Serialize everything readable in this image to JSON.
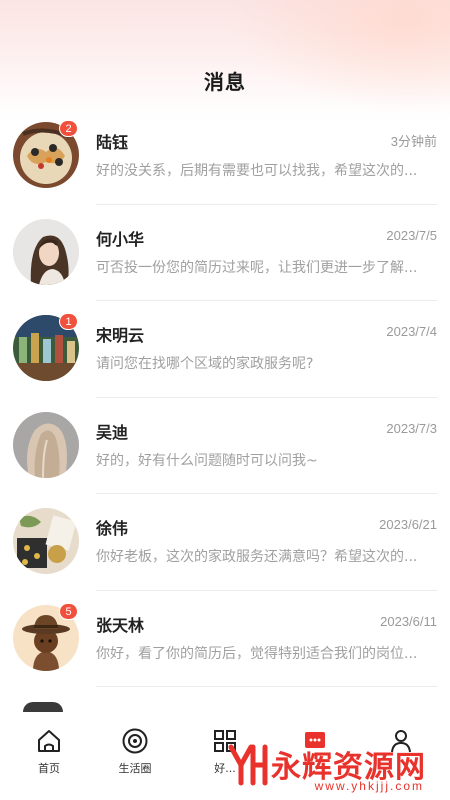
{
  "header": {
    "title": "消息"
  },
  "conversations": [
    {
      "name": "陆钰",
      "time": "3分钟前",
      "preview": "好的没关系，后期有需要也可以找我，希望这次的...",
      "badge": "2"
    },
    {
      "name": "何小华",
      "time": "2023/7/5",
      "preview": "可否投一份您的简历过来呢，让我们更进一步了解...",
      "badge": ""
    },
    {
      "name": "宋明云",
      "time": "2023/7/4",
      "preview": "请问您在找哪个区域的家政服务呢?",
      "badge": "1"
    },
    {
      "name": "吴迪",
      "time": "2023/7/3",
      "preview": "好的，好有什么问题随时可以问我~",
      "badge": ""
    },
    {
      "name": "徐伟",
      "time": "2023/6/21",
      "preview": "你好老板，这次的家政服务还满意吗？希望这次的...",
      "badge": ""
    },
    {
      "name": "张天林",
      "time": "2023/6/11",
      "preview": "你好，看了你的简历后，觉得特别适合我们的岗位...",
      "badge": "5"
    }
  ],
  "tabbar": {
    "tabs": [
      {
        "label": "首页",
        "icon": "home-icon"
      },
      {
        "label": "生活圈",
        "icon": "target-icon"
      },
      {
        "label": "好...",
        "icon": "grid-icon"
      },
      {
        "label": "",
        "icon": "message-icon"
      },
      {
        "label": "",
        "icon": "user-icon"
      }
    ]
  },
  "watermark": {
    "text": "永辉资源网",
    "url": "www.yhkjjj.com"
  },
  "colors": {
    "badge": "#f0503c",
    "watermark": "#e8322b",
    "header_gradient": "#fbe4e4"
  }
}
